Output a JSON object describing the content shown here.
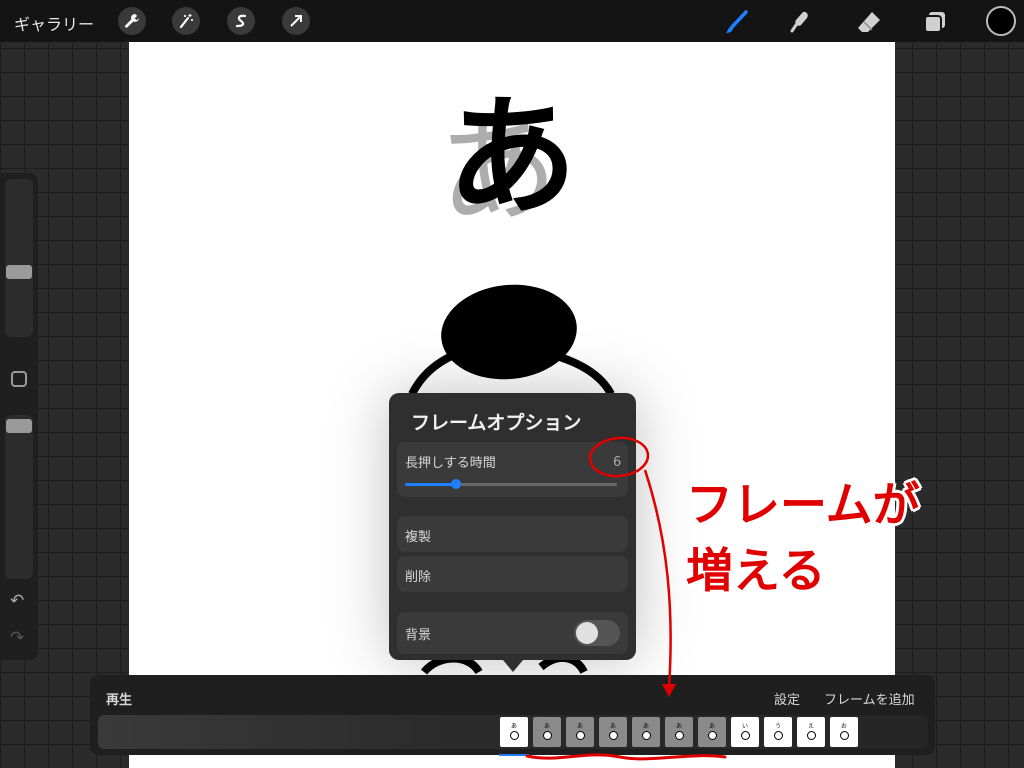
{
  "topbar": {
    "gallery_label": "ギャラリー",
    "left_tools": [
      "wrench-icon",
      "magic-wand-icon",
      "selection-icon",
      "transform-arrow-icon"
    ],
    "right_tools": [
      "brush-icon",
      "smudge-icon",
      "eraser-icon",
      "layers-icon"
    ],
    "active_tool": "brush-icon",
    "color_swatch": "#000000"
  },
  "canvas": {
    "glyph": "あ",
    "ghost_glyph": "あ"
  },
  "frame_options": {
    "title": "フレームオプション",
    "hold_label": "長押しする時間",
    "hold_value": "6",
    "hold_slider_fraction": 0.24,
    "duplicate_label": "複製",
    "delete_label": "削除",
    "background_label": "背景",
    "background_on": false
  },
  "timeline": {
    "play_label": "再生",
    "settings_label": "設定",
    "add_frame_label": "フレームを追加",
    "accent": "#1f7fff",
    "frames": [
      {
        "ch": "あ",
        "fill": "#ffffff",
        "selected": true
      },
      {
        "ch": "あ",
        "fill": "#8a8a8a"
      },
      {
        "ch": "あ",
        "fill": "#8a8a8a"
      },
      {
        "ch": "あ",
        "fill": "#8a8a8a"
      },
      {
        "ch": "あ",
        "fill": "#8a8a8a"
      },
      {
        "ch": "あ",
        "fill": "#8a8a8a"
      },
      {
        "ch": "あ",
        "fill": "#8a8a8a"
      },
      {
        "ch": "い",
        "fill": "#ffffff"
      },
      {
        "ch": "う",
        "fill": "#ffffff"
      },
      {
        "ch": "え",
        "fill": "#ffffff"
      },
      {
        "ch": "お",
        "fill": "#ffffff"
      }
    ]
  },
  "annotation": {
    "line1": "フレームが",
    "line2": "増える",
    "color": "#e00000"
  }
}
